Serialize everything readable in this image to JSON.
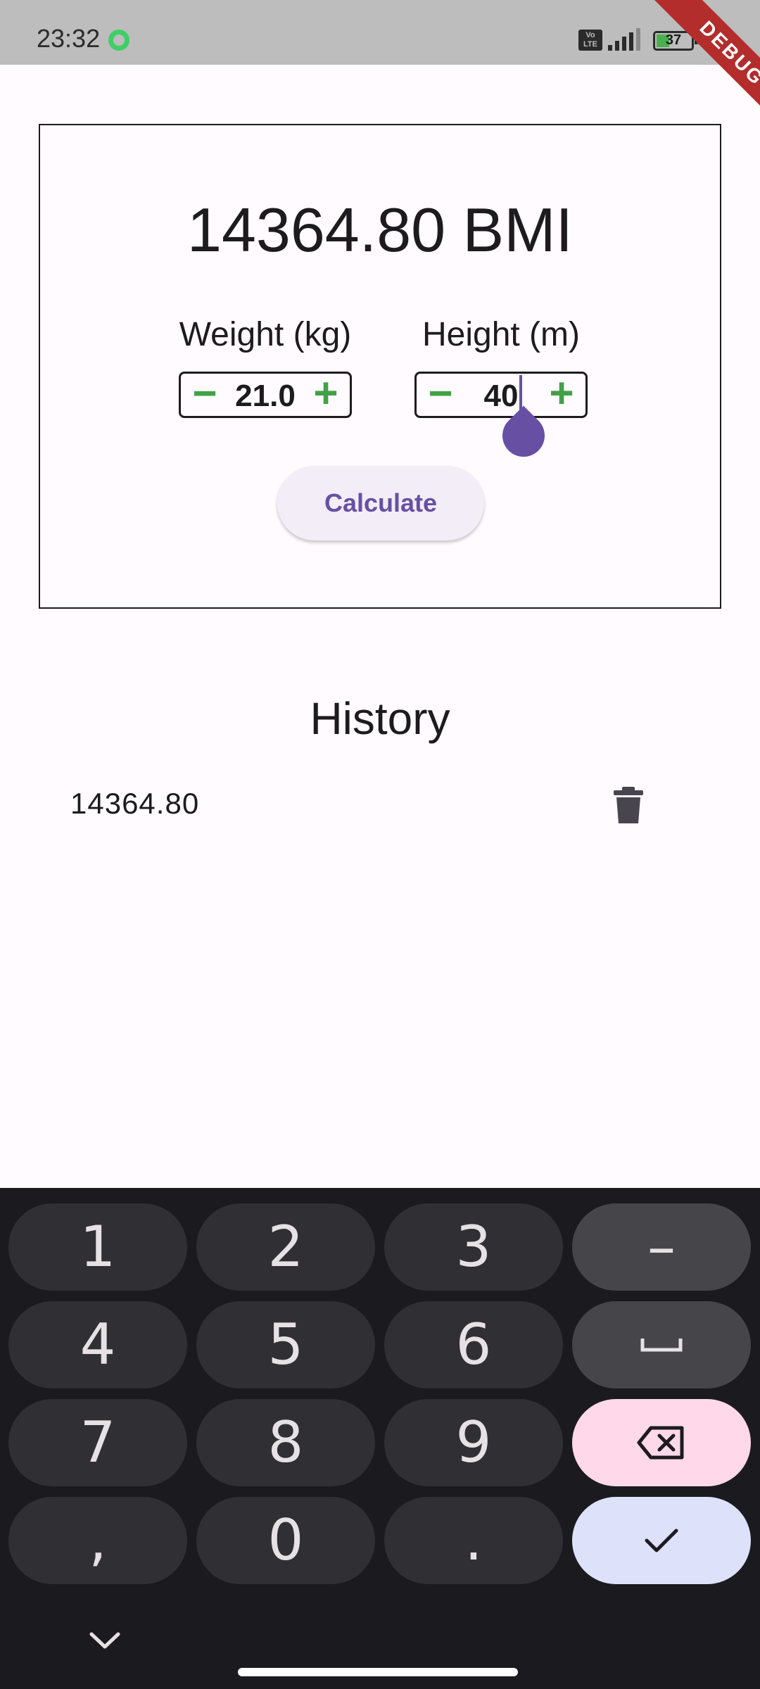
{
  "status_bar": {
    "time": "23:32",
    "network_badge": "Vo LTE",
    "battery_level": "37"
  },
  "debug_banner": "DEBUG",
  "calculator": {
    "result": "14364.80 BMI",
    "weight": {
      "label": "Weight (kg)",
      "value": "21.0",
      "decrement": "−",
      "increment": "+"
    },
    "height": {
      "label": "Height (m)",
      "value": "40",
      "decrement": "−",
      "increment": "+"
    },
    "calculate_label": "Calculate"
  },
  "history": {
    "title": "History",
    "items": [
      {
        "value": "14364.80"
      }
    ]
  },
  "keyboard": {
    "rows": [
      [
        "1",
        "2",
        "3",
        "–"
      ],
      [
        "4",
        "5",
        "6",
        "␣"
      ],
      [
        "7",
        "8",
        "9",
        "⌫"
      ],
      [
        ",",
        "0",
        ".",
        "✓"
      ]
    ]
  },
  "colors": {
    "accent": "#6750a4",
    "stepper_icons": "#43a047",
    "backspace_key": "#ffd8e9",
    "done_key": "#dde1fa",
    "keyboard_bg": "#1b1b1f"
  }
}
